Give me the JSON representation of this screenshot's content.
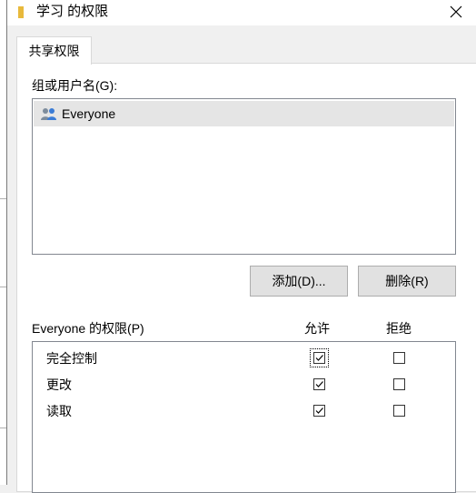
{
  "window": {
    "title": "学习 的权限",
    "close_glyph": "✕"
  },
  "tabs": [
    {
      "label": "共享权限",
      "selected": true
    }
  ],
  "group": {
    "label": "组或用户名(G):",
    "users": [
      {
        "name": "Everyone",
        "icon": "users-group-icon",
        "selected": true
      }
    ]
  },
  "buttons": {
    "add": "添加(D)...",
    "remove": "删除(R)"
  },
  "permissions": {
    "title": "Everyone 的权限(P)",
    "allow_header": "允许",
    "deny_header": "拒绝",
    "rows": [
      {
        "name": "完全控制",
        "allow": true,
        "deny": false,
        "focused": true
      },
      {
        "name": "更改",
        "allow": true,
        "deny": false,
        "focused": false
      },
      {
        "name": "读取",
        "allow": true,
        "deny": false,
        "focused": false
      }
    ]
  },
  "colors": {
    "folder_icon": "#e8b93c",
    "selection": "#e5e5e5"
  }
}
